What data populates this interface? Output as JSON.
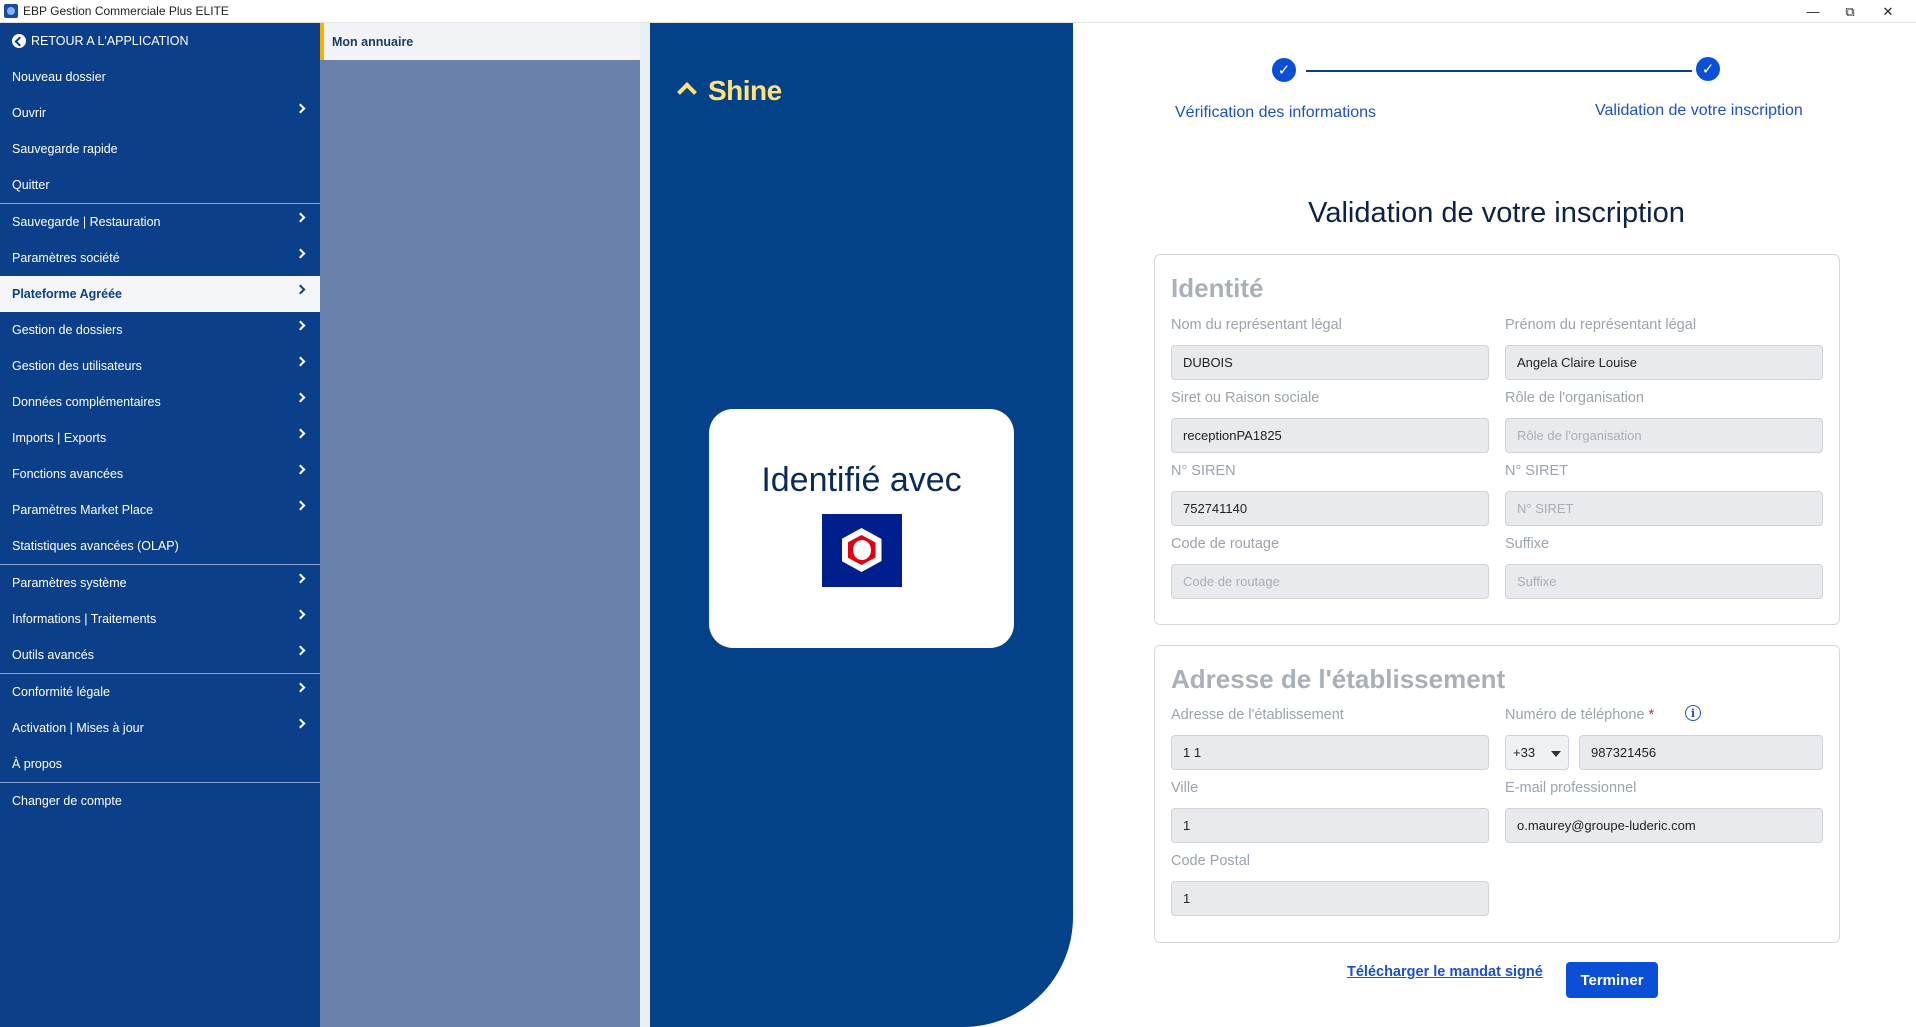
{
  "window": {
    "title": "EBP Gestion Commerciale Plus ELITE",
    "controls": {
      "minimize": "—",
      "restore": "⧉",
      "close": "✕"
    }
  },
  "sidebar": {
    "back_label": "RETOUR A L'APPLICATION",
    "items": [
      {
        "label": "Nouveau dossier"
      },
      {
        "label": "Ouvrir"
      },
      {
        "label": "Sauvegarde rapide"
      },
      {
        "label": "Quitter"
      },
      {
        "label": "Sauvegarde | Restauration"
      },
      {
        "label": "Paramètres société"
      },
      {
        "label": "Plateforme Agréée"
      },
      {
        "label": "Gestion de dossiers"
      },
      {
        "label": "Gestion des utilisateurs"
      },
      {
        "label": "Données complémentaires"
      },
      {
        "label": "Imports | Exports"
      },
      {
        "label": "Fonctions avancées"
      },
      {
        "label": "Paramètres Market Place"
      },
      {
        "label": "Statistiques avancées (OLAP)"
      },
      {
        "label": "Paramètres système"
      },
      {
        "label": "Informations | Traitements"
      },
      {
        "label": "Outils avancés"
      },
      {
        "label": "Conformité légale"
      },
      {
        "label": "Activation | Mises à jour"
      },
      {
        "label": "À propos"
      },
      {
        "label": "Changer de compte"
      }
    ]
  },
  "submenu": {
    "header": "Mon annuaire"
  },
  "shine": {
    "logo_text": "Shine",
    "identified_with": "Identifié avec",
    "provider_icon": "franceconnect-icon"
  },
  "stepper": {
    "step1": "Vérification des informations",
    "step2": "Validation de votre inscription",
    "check": "✓"
  },
  "form": {
    "title": "Validation de votre inscription",
    "identity": {
      "title": "Identité",
      "nom_label": "Nom du représentant légal",
      "nom_value": "DUBOIS",
      "prenom_label": "Prénom du représentant légal",
      "prenom_value": "Angela Claire Louise",
      "siret_rs_label": "Siret ou Raison sociale",
      "siret_rs_value": "receptionPA1825",
      "role_label": "Rôle de l'organisation",
      "role_placeholder": "Rôle de l'organisation",
      "siren_label": "N° SIREN",
      "siren_value": "752741140",
      "siret_label": "N° SIRET",
      "siret_placeholder": "N° SIRET",
      "routage_label": "Code de routage",
      "routage_placeholder": "Code de routage",
      "suffixe_label": "Suffixe",
      "suffixe_placeholder": "Suffixe"
    },
    "address": {
      "title": "Adresse de l'établissement",
      "adresse_label": "Adresse de l'établissement",
      "adresse_value": "1 1",
      "tel_label": "Numéro de téléphone",
      "required_mark": "*",
      "info_glyph": "i",
      "country_code": "+33",
      "tel_value": "987321456",
      "ville_label": "Ville",
      "ville_value": "1",
      "email_label": "E-mail professionnel",
      "email_value": "o.maurey@groupe-luderic.com",
      "cp_label": "Code Postal",
      "cp_value": "1"
    },
    "download_link": "Télécharger le mandat signé",
    "finish_button": "Terminer"
  }
}
